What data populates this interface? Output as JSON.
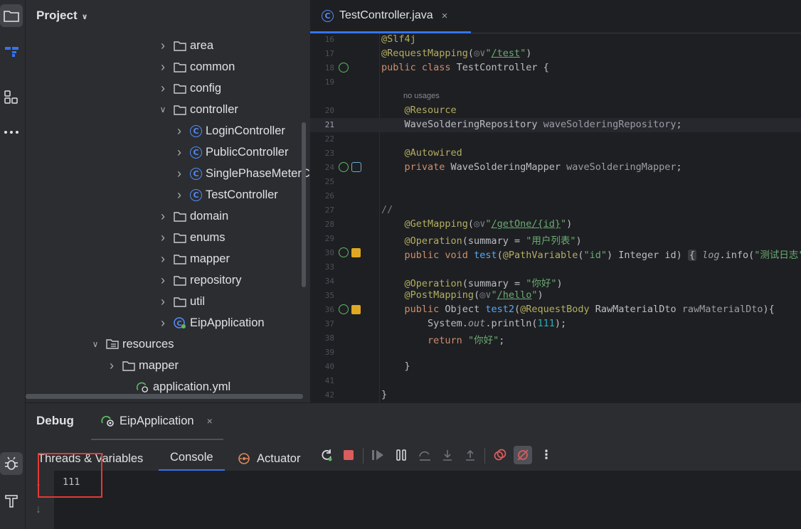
{
  "project_panel": {
    "title": "Project",
    "tree": [
      {
        "label": "area",
        "kind": "folder",
        "expanded": false
      },
      {
        "label": "common",
        "kind": "folder",
        "expanded": false
      },
      {
        "label": "config",
        "kind": "folder",
        "expanded": false
      },
      {
        "label": "controller",
        "kind": "folder",
        "expanded": true
      },
      {
        "label": "LoginController",
        "kind": "class",
        "expanded": false
      },
      {
        "label": "PublicController",
        "kind": "class",
        "expanded": false
      },
      {
        "label": "SinglePhaseMeterC",
        "kind": "class",
        "expanded": false
      },
      {
        "label": "TestController",
        "kind": "class",
        "expanded": false
      },
      {
        "label": "domain",
        "kind": "folder",
        "expanded": false
      },
      {
        "label": "enums",
        "kind": "folder",
        "expanded": false
      },
      {
        "label": "mapper",
        "kind": "folder",
        "expanded": false
      },
      {
        "label": "repository",
        "kind": "folder",
        "expanded": false
      },
      {
        "label": "util",
        "kind": "folder",
        "expanded": false
      },
      {
        "label": "EipApplication",
        "kind": "app",
        "expanded": false
      },
      {
        "label": "resources",
        "kind": "resfolder",
        "expanded": true
      },
      {
        "label": "mapper",
        "kind": "folder",
        "expanded": false
      },
      {
        "label": "application.yml",
        "kind": "yml",
        "expanded": null
      }
    ]
  },
  "editor": {
    "tab_label": "TestController.java",
    "tab_close": "×",
    "current_line": "21",
    "line_numbers": [
      "16",
      "17",
      "18",
      "19",
      "20",
      "21",
      "22",
      "23",
      "24",
      "25",
      "26",
      "27",
      "28",
      "29",
      "30",
      "33",
      "34",
      "35",
      "36",
      "37",
      "38",
      "39",
      "40",
      "41",
      "42"
    ],
    "no_usages_hint": "no usages"
  },
  "debug_panel": {
    "title": "Debug",
    "session_tab": "EipApplication",
    "session_close": "×",
    "tabs": {
      "threads": "Threads & Variables",
      "console": "Console",
      "actuator": "Actuator"
    },
    "more": "⋮",
    "console_output": "111"
  },
  "colors": {
    "accent": "#3574f0",
    "highlight_box": "#e53935",
    "class_icon": "#548af7"
  }
}
